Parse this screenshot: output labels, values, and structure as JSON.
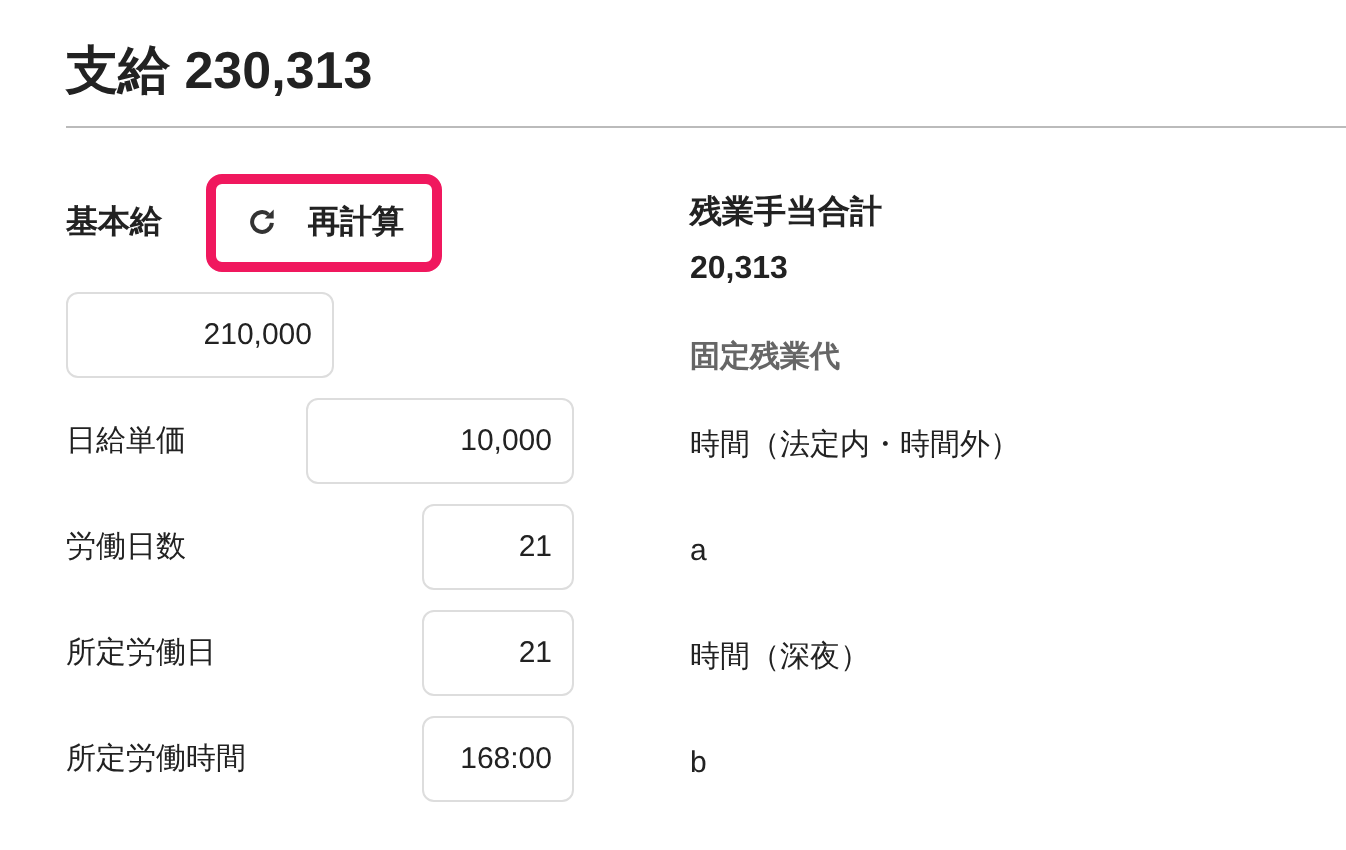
{
  "title": "支給 230,313",
  "base_salary": {
    "label": "基本給",
    "value": "210,000"
  },
  "recalc_button": {
    "label": "再計算",
    "highlighted": true
  },
  "fields": [
    {
      "label": "日給単価",
      "value": "10,000",
      "kind": "amount"
    },
    {
      "label": "労働日数",
      "value": "21",
      "kind": "count"
    },
    {
      "label": "所定労働日",
      "value": "21",
      "kind": "count"
    },
    {
      "label": "所定労働時間",
      "value": "168:00",
      "kind": "count"
    }
  ],
  "overtime": [
    {
      "text": "残業手当合計",
      "kind": "heading"
    },
    {
      "text": "20,313",
      "kind": "total"
    },
    {
      "text": "固定残業代",
      "kind": "section"
    },
    {
      "text": "時間（法定内・時間外）",
      "kind": "label"
    },
    {
      "text": "a",
      "kind": "label"
    },
    {
      "text": "時間（深夜）",
      "kind": "label"
    },
    {
      "text": "b",
      "kind": "label"
    }
  ]
}
